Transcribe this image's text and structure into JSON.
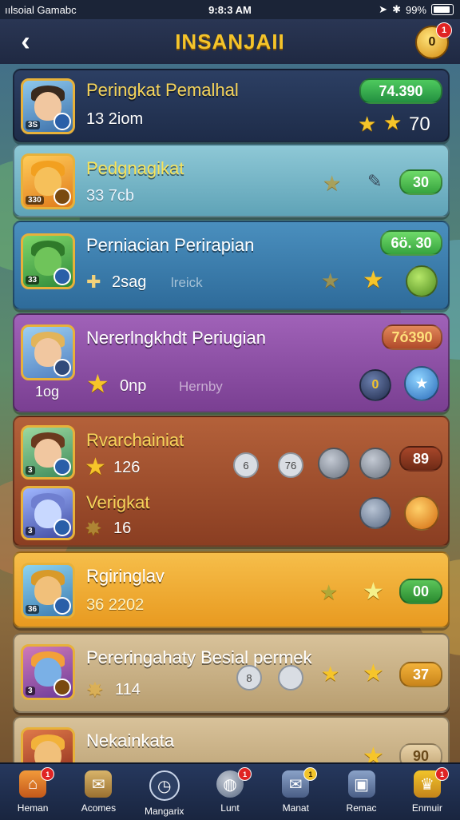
{
  "status": {
    "carrier": "ıılsoial Gamabc",
    "time": "9:8:3 AM",
    "battery": "99%"
  },
  "header": {
    "title": "INSANJAII",
    "back_icon": "chevron-left-icon",
    "right_icon_label": "0",
    "right_badge": "1"
  },
  "cards": [
    {
      "name": "Peringkat Pemalhal",
      "sub": "13 2iom",
      "value": "74.390",
      "stars_value": "70",
      "level": "3S"
    },
    {
      "name": "Pedgnagikat",
      "sub": "33 7cb",
      "value": "30",
      "level": "330"
    },
    {
      "name": "Perniacian Perirapian",
      "sub": "2sag",
      "sub_extra": "lreick",
      "value": "6ö. 30",
      "level": "33"
    },
    {
      "name": "Nererlngkhdt Periugian",
      "sub": "0np",
      "sub_extra": "Hernby",
      "value": "7ó390",
      "avatar_label": "1og",
      "gem_label": "0"
    },
    {
      "name": "Rvarchainiat",
      "sub": "126",
      "value": "89",
      "coin1": "6",
      "coin2": "76",
      "level": "3"
    },
    {
      "name": "Verigkat",
      "sub": "16",
      "level": "3"
    },
    {
      "name": "Rgiringlav",
      "sub": "36 2202",
      "value": "00",
      "level": "36"
    },
    {
      "name": "Pereringahaty Besial permek",
      "sub": "114",
      "value": "37",
      "coin1": "8",
      "level": "3"
    },
    {
      "name": "Nekainkata",
      "value": "90"
    }
  ],
  "tabs": [
    {
      "label": "Heman",
      "icon": "home-icon",
      "badge": "1"
    },
    {
      "label": "Acomes",
      "icon": "map-icon",
      "badge": ""
    },
    {
      "label": "Mangarix",
      "icon": "clock-icon",
      "badge": ""
    },
    {
      "label": "Lunt",
      "icon": "globe-icon",
      "badge": "1"
    },
    {
      "label": "Manat",
      "icon": "mail-icon",
      "badge": "1"
    },
    {
      "label": "Remac",
      "icon": "chest-icon",
      "badge": ""
    },
    {
      "label": "Enmuir",
      "icon": "trophy-icon",
      "badge": "1"
    }
  ]
}
